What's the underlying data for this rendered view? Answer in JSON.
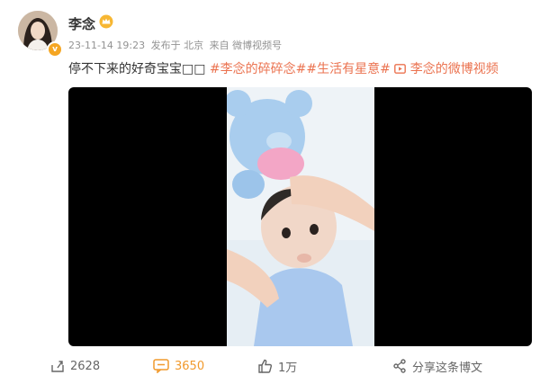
{
  "post": {
    "author": "李念",
    "verified_badge": "v",
    "timestamp": "23-11-14 19:23",
    "location": "发布于 北京",
    "source": "来自 微博视频号",
    "text_plain": "停不下来的好奇宝宝",
    "text_emoji": "□□",
    "tags": [
      "#李念的碎碎念#",
      "#生活有星意#"
    ],
    "video_link": "李念的微博视频"
  },
  "actions": {
    "share_count": "2628",
    "comment_count": "3650",
    "like_count": "1万",
    "share_post_label": "分享这条博文"
  },
  "colors": {
    "accent": "#eb7350",
    "comment_highlight": "#f19a2d",
    "meta_gray": "#939393"
  }
}
